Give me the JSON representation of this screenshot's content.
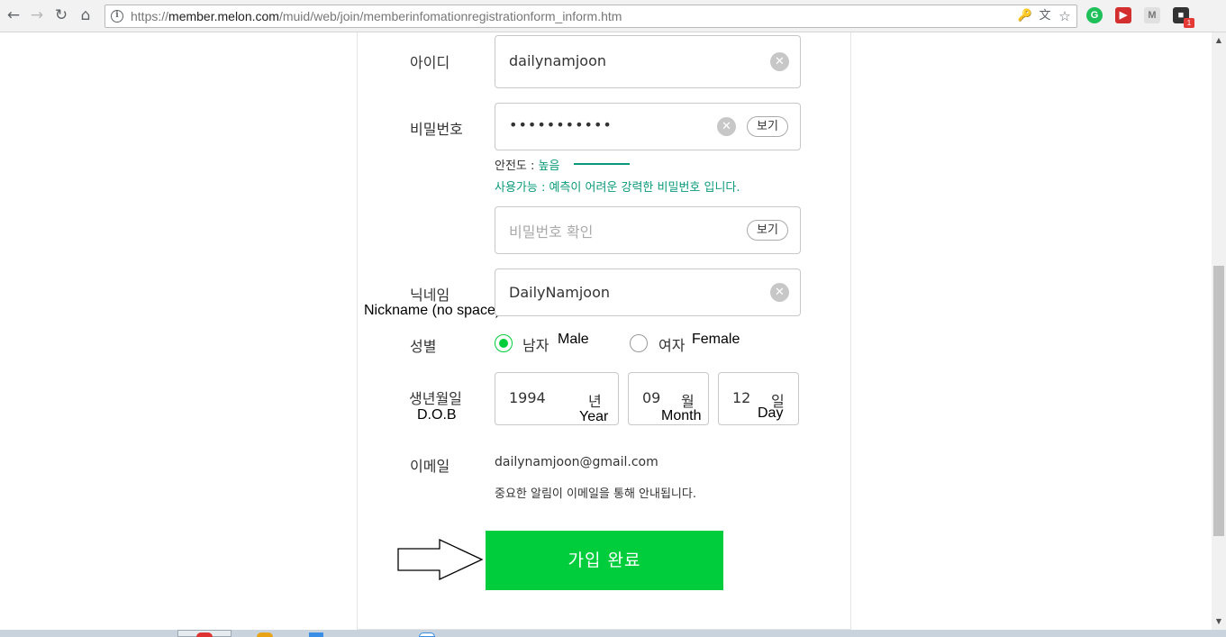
{
  "browser": {
    "url_prefix": "https://",
    "url_host": "member.melon.com",
    "url_path": "/muid/web/join/memberinfomationregistrationform_inform.htm",
    "ext_badge_count": "1",
    "icons": [
      "back-icon",
      "forward-icon",
      "reload-icon",
      "home-icon",
      "info-icon",
      "key-icon",
      "translate-icon",
      "star-icon"
    ]
  },
  "form": {
    "id": {
      "label": "아이디",
      "value": "dailynamjoon"
    },
    "password": {
      "label": "비밀번호",
      "value": "•••••••••••",
      "show_label": "보기",
      "strength_prefix": "안전도 : ",
      "strength_value": "높음",
      "message": "사용가능 : 예측이 어려운 강력한 비밀번호 입니다."
    },
    "password_confirm": {
      "placeholder": "비밀번호 확인",
      "show_label": "보기"
    },
    "nickname": {
      "label": "닉네임",
      "annotation": "Nickname (no space)",
      "value": "DailyNamjoon"
    },
    "gender": {
      "label": "성별",
      "male_label": "남자",
      "male_annotation": "Male",
      "female_label": "여자",
      "female_annotation": "Female",
      "selected": "male"
    },
    "dob": {
      "label": "생년월일",
      "annotation": "D.O.B",
      "year": "1994",
      "year_unit": "년",
      "year_annotation": "Year",
      "month": "09",
      "month_unit": "월",
      "month_annotation": "Month",
      "day": "12",
      "day_unit": "일",
      "day_annotation": "Day"
    },
    "email": {
      "label": "이메일",
      "value": "dailynamjoon@gmail.com",
      "note": "중요한 알림이 이메일을 통해 안내됩니다."
    },
    "submit_label": "가입 완료"
  },
  "colors": {
    "accent_green": "#00cd3c",
    "hint_teal": "#0a9a7a"
  }
}
